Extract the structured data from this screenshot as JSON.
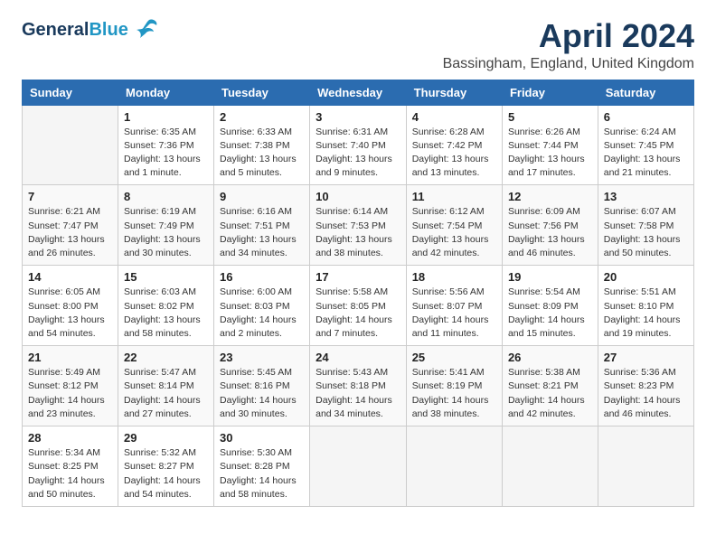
{
  "header": {
    "logo_general": "General",
    "logo_blue": "Blue",
    "month_year": "April 2024",
    "location": "Bassingham, England, United Kingdom"
  },
  "weekdays": [
    "Sunday",
    "Monday",
    "Tuesday",
    "Wednesday",
    "Thursday",
    "Friday",
    "Saturday"
  ],
  "weeks": [
    [
      {
        "day": "",
        "info": ""
      },
      {
        "day": "1",
        "info": "Sunrise: 6:35 AM\nSunset: 7:36 PM\nDaylight: 13 hours\nand 1 minute."
      },
      {
        "day": "2",
        "info": "Sunrise: 6:33 AM\nSunset: 7:38 PM\nDaylight: 13 hours\nand 5 minutes."
      },
      {
        "day": "3",
        "info": "Sunrise: 6:31 AM\nSunset: 7:40 PM\nDaylight: 13 hours\nand 9 minutes."
      },
      {
        "day": "4",
        "info": "Sunrise: 6:28 AM\nSunset: 7:42 PM\nDaylight: 13 hours\nand 13 minutes."
      },
      {
        "day": "5",
        "info": "Sunrise: 6:26 AM\nSunset: 7:44 PM\nDaylight: 13 hours\nand 17 minutes."
      },
      {
        "day": "6",
        "info": "Sunrise: 6:24 AM\nSunset: 7:45 PM\nDaylight: 13 hours\nand 21 minutes."
      }
    ],
    [
      {
        "day": "7",
        "info": "Sunrise: 6:21 AM\nSunset: 7:47 PM\nDaylight: 13 hours\nand 26 minutes."
      },
      {
        "day": "8",
        "info": "Sunrise: 6:19 AM\nSunset: 7:49 PM\nDaylight: 13 hours\nand 30 minutes."
      },
      {
        "day": "9",
        "info": "Sunrise: 6:16 AM\nSunset: 7:51 PM\nDaylight: 13 hours\nand 34 minutes."
      },
      {
        "day": "10",
        "info": "Sunrise: 6:14 AM\nSunset: 7:53 PM\nDaylight: 13 hours\nand 38 minutes."
      },
      {
        "day": "11",
        "info": "Sunrise: 6:12 AM\nSunset: 7:54 PM\nDaylight: 13 hours\nand 42 minutes."
      },
      {
        "day": "12",
        "info": "Sunrise: 6:09 AM\nSunset: 7:56 PM\nDaylight: 13 hours\nand 46 minutes."
      },
      {
        "day": "13",
        "info": "Sunrise: 6:07 AM\nSunset: 7:58 PM\nDaylight: 13 hours\nand 50 minutes."
      }
    ],
    [
      {
        "day": "14",
        "info": "Sunrise: 6:05 AM\nSunset: 8:00 PM\nDaylight: 13 hours\nand 54 minutes."
      },
      {
        "day": "15",
        "info": "Sunrise: 6:03 AM\nSunset: 8:02 PM\nDaylight: 13 hours\nand 58 minutes."
      },
      {
        "day": "16",
        "info": "Sunrise: 6:00 AM\nSunset: 8:03 PM\nDaylight: 14 hours\nand 2 minutes."
      },
      {
        "day": "17",
        "info": "Sunrise: 5:58 AM\nSunset: 8:05 PM\nDaylight: 14 hours\nand 7 minutes."
      },
      {
        "day": "18",
        "info": "Sunrise: 5:56 AM\nSunset: 8:07 PM\nDaylight: 14 hours\nand 11 minutes."
      },
      {
        "day": "19",
        "info": "Sunrise: 5:54 AM\nSunset: 8:09 PM\nDaylight: 14 hours\nand 15 minutes."
      },
      {
        "day": "20",
        "info": "Sunrise: 5:51 AM\nSunset: 8:10 PM\nDaylight: 14 hours\nand 19 minutes."
      }
    ],
    [
      {
        "day": "21",
        "info": "Sunrise: 5:49 AM\nSunset: 8:12 PM\nDaylight: 14 hours\nand 23 minutes."
      },
      {
        "day": "22",
        "info": "Sunrise: 5:47 AM\nSunset: 8:14 PM\nDaylight: 14 hours\nand 27 minutes."
      },
      {
        "day": "23",
        "info": "Sunrise: 5:45 AM\nSunset: 8:16 PM\nDaylight: 14 hours\nand 30 minutes."
      },
      {
        "day": "24",
        "info": "Sunrise: 5:43 AM\nSunset: 8:18 PM\nDaylight: 14 hours\nand 34 minutes."
      },
      {
        "day": "25",
        "info": "Sunrise: 5:41 AM\nSunset: 8:19 PM\nDaylight: 14 hours\nand 38 minutes."
      },
      {
        "day": "26",
        "info": "Sunrise: 5:38 AM\nSunset: 8:21 PM\nDaylight: 14 hours\nand 42 minutes."
      },
      {
        "day": "27",
        "info": "Sunrise: 5:36 AM\nSunset: 8:23 PM\nDaylight: 14 hours\nand 46 minutes."
      }
    ],
    [
      {
        "day": "28",
        "info": "Sunrise: 5:34 AM\nSunset: 8:25 PM\nDaylight: 14 hours\nand 50 minutes."
      },
      {
        "day": "29",
        "info": "Sunrise: 5:32 AM\nSunset: 8:27 PM\nDaylight: 14 hours\nand 54 minutes."
      },
      {
        "day": "30",
        "info": "Sunrise: 5:30 AM\nSunset: 8:28 PM\nDaylight: 14 hours\nand 58 minutes."
      },
      {
        "day": "",
        "info": ""
      },
      {
        "day": "",
        "info": ""
      },
      {
        "day": "",
        "info": ""
      },
      {
        "day": "",
        "info": ""
      }
    ]
  ]
}
